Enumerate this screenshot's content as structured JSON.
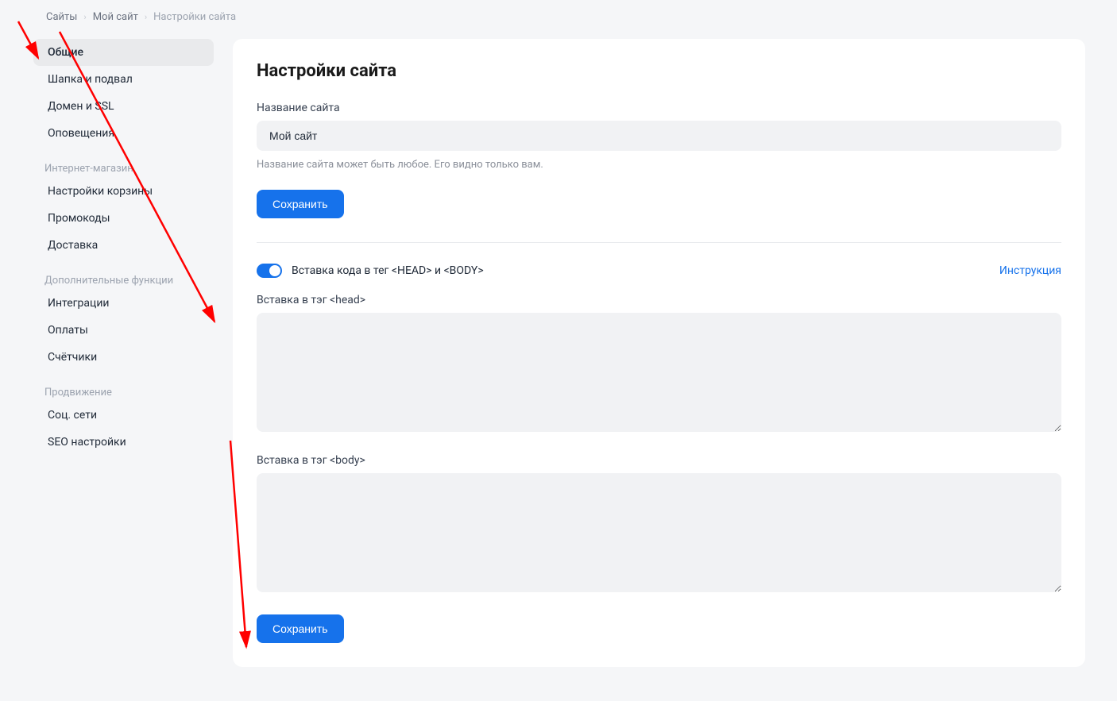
{
  "breadcrumb": {
    "items": [
      "Сайты",
      "Мой сайт",
      "Настройки сайта"
    ]
  },
  "sidebar": {
    "groups": [
      {
        "label": null,
        "items": [
          {
            "label": "Общие",
            "active": true
          },
          {
            "label": "Шапка и подвал",
            "active": false
          },
          {
            "label": "Домен и SSL",
            "active": false
          },
          {
            "label": "Оповещения",
            "active": false
          }
        ]
      },
      {
        "label": "Интернет-магазин",
        "items": [
          {
            "label": "Настройки корзины",
            "active": false
          },
          {
            "label": "Промокоды",
            "active": false
          },
          {
            "label": "Доставка",
            "active": false
          }
        ]
      },
      {
        "label": "Дополнительные функции",
        "items": [
          {
            "label": "Интеграции",
            "active": false
          },
          {
            "label": "Оплаты",
            "active": false
          },
          {
            "label": "Счётчики",
            "active": false
          }
        ]
      },
      {
        "label": "Продвижение",
        "items": [
          {
            "label": "Соц. сети",
            "active": false
          },
          {
            "label": "SEO настройки",
            "active": false
          }
        ]
      }
    ]
  },
  "main": {
    "title": "Настройки сайта",
    "siteNameLabel": "Название сайта",
    "siteNameValue": "Мой сайт",
    "siteNameHelp": "Название сайта может быть любое. Его видно только вам.",
    "saveButton1": "Сохранить",
    "toggleLabel": "Вставка кода в тег <HEAD> и <BODY>",
    "toggleOn": true,
    "instructionLink": "Инструкция",
    "headInsertLabel": "Вставка в тэг <head>",
    "headInsertValue": "",
    "bodyInsertLabel": "Вставка в тэг <body>",
    "bodyInsertValue": "",
    "saveButton2": "Сохранить"
  }
}
